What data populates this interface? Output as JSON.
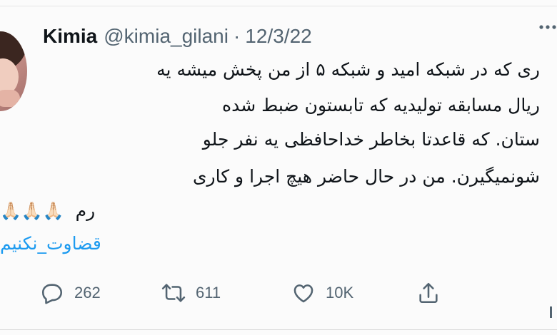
{
  "tweet": {
    "author_name": "Kimia",
    "handle": "@kimia_gilani",
    "separator": "·",
    "date": "12/3/22",
    "lines": [
      "ری که در شبکه امید و شبکه ۵ از من پخش میشه یه",
      "ریال مسابقه تولیدیه که تابستون ضبط شده",
      "ستان. که قاعدتا بخاطر خداحافظی یه نفر جلو",
      "شونمیگیرن. من در حال حاضر هیچ اجرا و کاری"
    ],
    "line5_text": "رم",
    "emoji": "🙏🏻🙏🏻🙏🏻",
    "hashtag": "قضاوت_نکنیم"
  },
  "actions": {
    "reply_count": "262",
    "retweet_count": "611",
    "like_count": "10K"
  },
  "icons": {
    "reply": "reply-icon",
    "retweet": "retweet-icon",
    "like": "heart-icon",
    "share": "share-icon",
    "more": "more-icon"
  },
  "colors": {
    "text": "#0f1419",
    "secondary": "#536471",
    "link": "#1d9bf0"
  }
}
